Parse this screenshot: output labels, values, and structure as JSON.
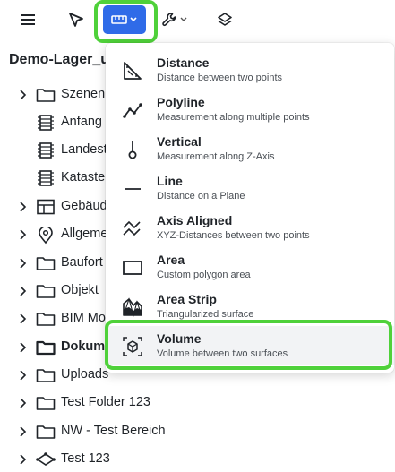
{
  "project": {
    "title": "Demo-Lager_u"
  },
  "tree": {
    "items": [
      {
        "label": "Szenen",
        "icon": "folder-icon",
        "expandable": true
      },
      {
        "label": "Anfang",
        "icon": "film-icon",
        "expandable": false
      },
      {
        "label": "Landest",
        "icon": "film-icon",
        "expandable": false
      },
      {
        "label": "Kataste",
        "icon": "film-icon",
        "expandable": false
      },
      {
        "label": "Gebäude",
        "icon": "layout-icon",
        "expandable": true
      },
      {
        "label": "Allgeme",
        "icon": "map-pin-icon",
        "expandable": true
      },
      {
        "label": "Baufort",
        "icon": "folder-icon",
        "expandable": true
      },
      {
        "label": "Objekt",
        "icon": "folder-icon",
        "expandable": true
      },
      {
        "label": "BIM Mo",
        "icon": "folder-icon",
        "expandable": true
      },
      {
        "label": "Dokum",
        "icon": "folder-icon",
        "expandable": true
      },
      {
        "label": "Uploads",
        "icon": "folder-icon",
        "expandable": true
      },
      {
        "label": "Test Folder 123",
        "icon": "folder-icon",
        "expandable": true
      },
      {
        "label": "NW - Test Bereich",
        "icon": "folder-icon",
        "expandable": true
      },
      {
        "label": "Test 123",
        "icon": "model-icon",
        "expandable": true
      }
    ]
  },
  "measure_menu": {
    "items": [
      {
        "title": "Distance",
        "desc": "Distance between two points",
        "icon": "distance-icon"
      },
      {
        "title": "Polyline",
        "desc": "Measurement along multiple points",
        "icon": "polyline-icon"
      },
      {
        "title": "Vertical",
        "desc": "Measurement along Z-Axis",
        "icon": "vertical-icon"
      },
      {
        "title": "Line",
        "desc": "Distance on a Plane",
        "icon": "line-icon"
      },
      {
        "title": "Axis Aligned",
        "desc": "XYZ-Distances between two points",
        "icon": "axis-aligned-icon"
      },
      {
        "title": "Area",
        "desc": "Custom polygon area",
        "icon": "area-icon"
      },
      {
        "title": "Area Strip",
        "desc": "Triangularized surface",
        "icon": "area-strip-icon"
      },
      {
        "title": "Volume",
        "desc": "Volume between two surfaces",
        "icon": "volume-icon"
      }
    ]
  },
  "colors": {
    "accent": "#2f6be8",
    "highlight": "#4fd13a"
  }
}
